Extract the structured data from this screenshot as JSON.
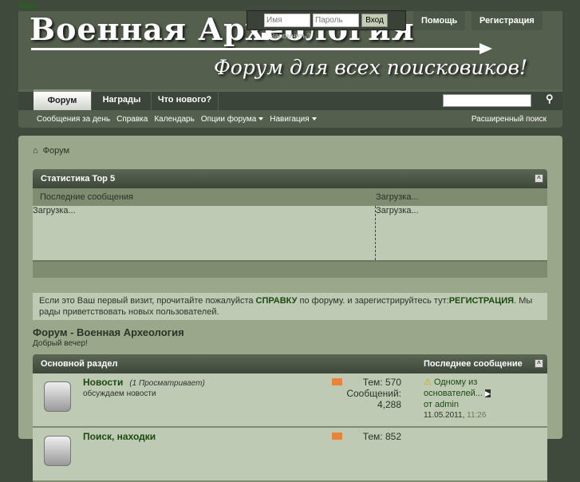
{
  "top_word": "Яше",
  "logo": {
    "title": "Военная Археология",
    "slogan": "Форум для всех поисковиков!"
  },
  "login": {
    "username_placeholder": "Имя",
    "password_placeholder": "Пароль",
    "submit": "Вход",
    "remember": "Запомнить?"
  },
  "top_buttons": [
    "Помощь",
    "Регистрация"
  ],
  "tabs": [
    "Форум",
    "Награды",
    "Что нового?"
  ],
  "subnav": {
    "items": [
      "Сообщения за день",
      "Справка",
      "Календарь",
      "Опции форума",
      "Навигация"
    ],
    "advanced_search": "Расширенный поиск"
  },
  "breadcrumb": "Форум",
  "stats": {
    "title": "Статистика Top 5",
    "col1": "Последние сообщения",
    "col2": "Загрузка...",
    "body1": "Загрузка...",
    "body2": "Загрузка..."
  },
  "notice": {
    "text1": "Если это Ваш первый визит, прочитайте пожалуйста ",
    "link1": "СПРАВКУ",
    "text2": " по форуму. и зарегистрируйтесь тут:",
    "link2": "РЕГИСТРАЦИЯ",
    "text3": ". Мы рады приветствовать новых пользователей."
  },
  "forum_title": "Форум - Военная Археология",
  "greeting": "Добрый вечер!",
  "section": {
    "title": "Основной раздел",
    "last_post": "Последнее сообщение"
  },
  "forums": [
    {
      "name": "Новости",
      "views": "(1 Просматривает)",
      "desc": "обсуждаем новости",
      "topics": "Тем: 570",
      "posts_label": "Сообщений:",
      "posts": "4,288",
      "last_title": "Одному из основателей...",
      "last_by": "от admin",
      "last_date": "11.05.2011,",
      "last_time": "11:26"
    },
    {
      "name": "Поиск, находки",
      "topics": "Тем: 852"
    }
  ]
}
